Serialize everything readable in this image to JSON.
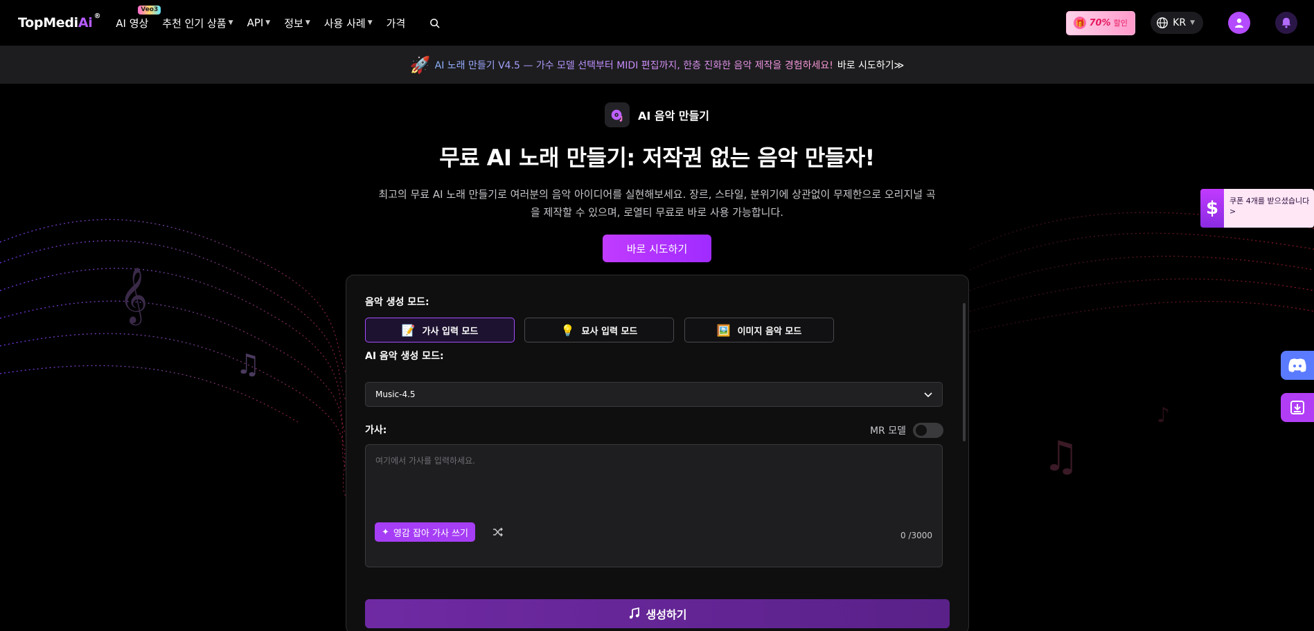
{
  "nav": {
    "logo_main": "TopMedi",
    "logo_ai": "Ai",
    "logo_reg": "®",
    "items": [
      {
        "label": "AI 영상",
        "badge": "Veo3",
        "caret": false
      },
      {
        "label": "추천 인기 상품",
        "caret": true
      },
      {
        "label": "API",
        "caret": true
      },
      {
        "label": "정보",
        "caret": true
      },
      {
        "label": "사용 사례",
        "caret": true
      },
      {
        "label": "가격",
        "caret": false
      }
    ],
    "promo_percent": "70%",
    "promo_label": "할인",
    "lang": "KR"
  },
  "announce": {
    "text": "AI 노래 만들기 V4.5 — 가수 모델 선택부터 MIDI 편집까지, 한층 진화한 음악 제작을 경험하세요!",
    "cta": "바로 시도하기≫"
  },
  "hero": {
    "tag": "AI 음악 만들기",
    "title": "무료 AI 노래 만들기: 저작권 없는 음악 만들자!",
    "desc": "최고의 무료 AI 노래 만들기로 여러분의 음악 아이디어를 실현해보세요. 장르, 스타일, 분위기에 상관없이 무제한으로 오리지널 곡을 제작할 수 있으며, 로열티 무료로 바로 사용 가능합니다.",
    "cta": "바로 시도하기"
  },
  "coupon": {
    "symbol": "$",
    "text": "쿠폰 4개를 받으셨습니다 >"
  },
  "panel": {
    "mode_label": "음악 생성 모드:",
    "modes": [
      {
        "icon": "📝",
        "label": "가사 입력 모드",
        "active": true
      },
      {
        "icon": "💡",
        "label": "묘사 입력 모드",
        "active": false
      },
      {
        "icon": "🖼️",
        "label": "이미지 음악 모드",
        "active": false
      }
    ],
    "ai_mode_label": "AI 음악 생성 모드:",
    "model_value": "Music-4.5",
    "lyrics_label": "가사:",
    "mr_label": "MR 모델",
    "mr_enabled": false,
    "lyrics_placeholder": "여기에서 가사를 입력하세요.",
    "inspire_label": "영감 잡아 가사 쓰기",
    "counter": "0 /3000",
    "generate_label": "생성하기"
  },
  "colors": {
    "accent": "#a63ef5",
    "background": "#000000",
    "panel": "#0f0f10"
  }
}
